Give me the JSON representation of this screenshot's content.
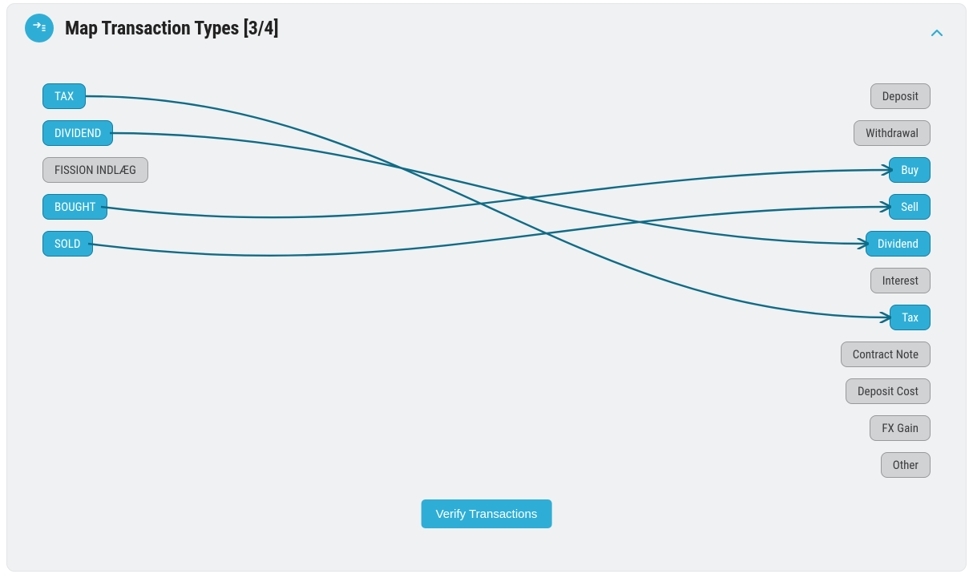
{
  "header": {
    "title": "Map Transaction Types [3/4]"
  },
  "source_items": [
    {
      "label": "TAX",
      "active": true
    },
    {
      "label": "DIVIDEND",
      "active": true
    },
    {
      "label": "FISSION INDLÆG",
      "active": false
    },
    {
      "label": "BOUGHT",
      "active": true
    },
    {
      "label": "SOLD",
      "active": true
    }
  ],
  "target_items": [
    {
      "label": "Deposit",
      "active": false
    },
    {
      "label": "Withdrawal",
      "active": false
    },
    {
      "label": "Buy",
      "active": true
    },
    {
      "label": "Sell",
      "active": true
    },
    {
      "label": "Dividend",
      "active": true
    },
    {
      "label": "Interest",
      "active": false
    },
    {
      "label": "Tax",
      "active": true
    },
    {
      "label": "Contract Note",
      "active": false
    },
    {
      "label": "Deposit Cost",
      "active": false
    },
    {
      "label": "FX Gain",
      "active": false
    },
    {
      "label": "Other",
      "active": false
    }
  ],
  "mappings": [
    {
      "source": "TAX",
      "target": "Tax"
    },
    {
      "source": "DIVIDEND",
      "target": "Dividend"
    },
    {
      "source": "BOUGHT",
      "target": "Buy"
    },
    {
      "source": "SOLD",
      "target": "Sell"
    }
  ],
  "actions": {
    "verify_label": "Verify Transactions"
  },
  "colors": {
    "accent": "#2eaed6",
    "stroke": "#0e6c87"
  }
}
